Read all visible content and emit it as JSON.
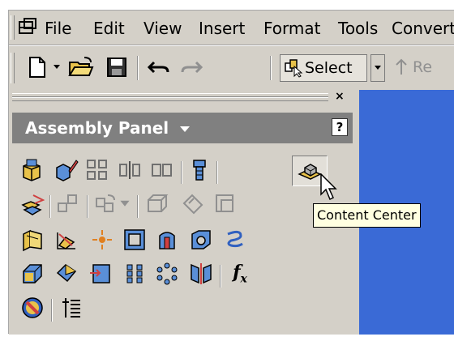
{
  "menubar": {
    "items": [
      "File",
      "Edit",
      "View",
      "Insert",
      "Format",
      "Tools",
      "Convert"
    ]
  },
  "toolbar": {
    "select_label": "Select",
    "return_label": "Re"
  },
  "panel": {
    "title": "Assembly Panel",
    "help_glyph": "?",
    "close_glyph": "×",
    "fx_label": "f"
  },
  "tooltip": {
    "text": "Content Center"
  },
  "colors": {
    "accent": "#3a6ad6",
    "panel_header": "#808080",
    "tooltip_bg": "#ffffe1"
  }
}
